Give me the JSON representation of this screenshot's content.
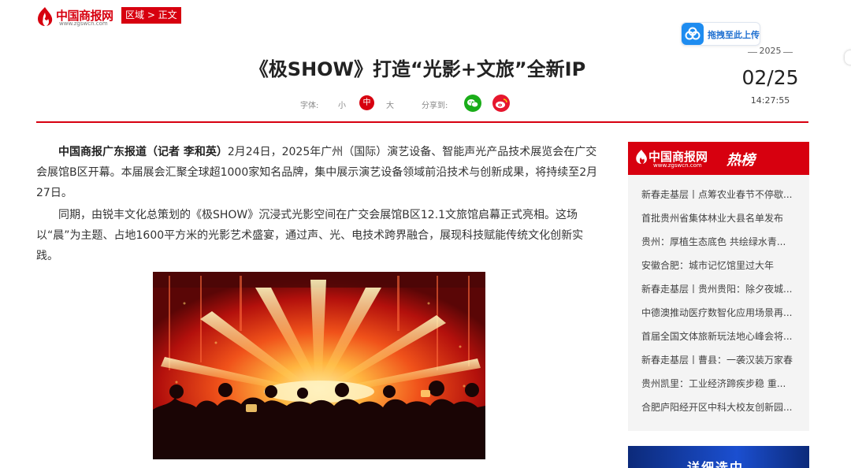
{
  "header": {
    "logo_text": "中国商报网",
    "logo_url": "www.zgswcn.com",
    "breadcrumb": "区域 > 正文",
    "upload_label": "拖拽至此上传"
  },
  "article": {
    "title": "《极SHOW》打造“光影+文旅”全新IP",
    "date": {
      "year": "2025",
      "day": "02/25",
      "time": "14:27:55"
    },
    "toolbar": {
      "font_label": "字体:",
      "size_small": "小",
      "size_medium": "中",
      "size_large": "大",
      "share_label": "分享到:"
    },
    "paragraphs": [
      {
        "lead": "中国商报广东报道（记者 李和英）",
        "text": "2月24日，2025年广州（国际）演艺设备、智能声光产品技术展览会在广交会展馆B区开幕。本届展会汇聚全球超1000家知名品牌，集中展示演艺设备领域前沿技术与创新成果，将持续至2月27日。"
      },
      {
        "lead": "",
        "text": "同期，由锐丰文化总策划的《极SHOW》沉浸式光影空间在广交会展馆B区12.1文旅馆启幕正式亮相。这场以“晨”为主题、占地1600平方米的光影艺术盛宴，通过声、光、电技术跨界融合，展现科技赋能传统文化创新实践。"
      }
    ]
  },
  "sidebar": {
    "logo_text": "中国商报网",
    "logo_url": "www.zgswcn.com",
    "heading": "热榜",
    "items": [
      "新春走基层丨点筹农业春节不停歇...",
      "首批贵州省集体林业大县名单发布",
      "贵州：厚植生态底色 共绘绿水青...",
      "安徽合肥：城市记忆馆里过大年",
      "新春走基层丨贵州贵阳：除夕夜城...",
      "中德澳推动医疗数智化应用场景再...",
      "首届全国文体旅新玩法地心峰会将...",
      "新春走基层丨曹县：一袭汉装万家春",
      "贵州凯里：工业经济蹄疾步稳 重...",
      "合肥庐阳经开区中科大校友创新园..."
    ],
    "banner_text": "详细选中"
  },
  "colors": {
    "brand_red": "#d7000f",
    "wechat_green": "#1aad19",
    "weibo_red": "#e6162d",
    "upload_blue": "#1e8cf0"
  }
}
